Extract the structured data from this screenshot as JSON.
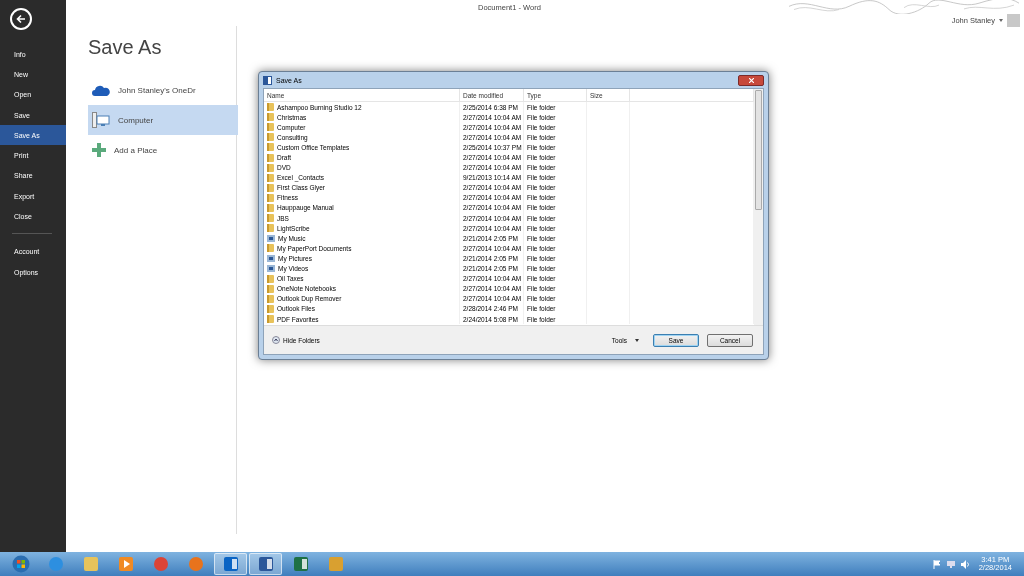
{
  "window": {
    "title": "Document1 - Word"
  },
  "account": {
    "name": "John Stanley"
  },
  "backstage": {
    "items": [
      {
        "label": "Info",
        "selected": false
      },
      {
        "label": "New",
        "selected": false
      },
      {
        "label": "Open",
        "selected": false
      },
      {
        "label": "Save",
        "selected": false
      },
      {
        "label": "Save As",
        "selected": true
      },
      {
        "label": "Print",
        "selected": false
      },
      {
        "label": "Share",
        "selected": false
      },
      {
        "label": "Export",
        "selected": false
      },
      {
        "label": "Close",
        "selected": false
      },
      {
        "label": "Account",
        "selected": false
      },
      {
        "label": "Options",
        "selected": false
      }
    ]
  },
  "page": {
    "title": "Save As",
    "places": [
      {
        "kind": "cloud",
        "label": "John Stanley's OneDr",
        "selected": false
      },
      {
        "kind": "computer",
        "label": "Computer",
        "selected": true
      },
      {
        "kind": "add",
        "label": "Add a Place",
        "selected": false
      }
    ]
  },
  "dialog": {
    "title": "Save As",
    "columns": [
      "Name",
      "Date modified",
      "Type",
      "Size"
    ],
    "rows": [
      {
        "kind": "folder",
        "name": "Ashampoo Burning Studio 12",
        "date": "2/25/2014 6:38 PM",
        "type": "File folder"
      },
      {
        "kind": "folder",
        "name": "Christmas",
        "date": "2/27/2014 10:04 AM",
        "type": "File folder"
      },
      {
        "kind": "folder",
        "name": "Computer",
        "date": "2/27/2014 10:04 AM",
        "type": "File folder"
      },
      {
        "kind": "folder",
        "name": "Consulting",
        "date": "2/27/2014 10:04 AM",
        "type": "File folder"
      },
      {
        "kind": "folder",
        "name": "Custom Office Templates",
        "date": "2/25/2014 10:37 PM",
        "type": "File folder"
      },
      {
        "kind": "folder",
        "name": "Draft",
        "date": "2/27/2014 10:04 AM",
        "type": "File folder"
      },
      {
        "kind": "folder",
        "name": "DVD",
        "date": "2/27/2014 10:04 AM",
        "type": "File folder"
      },
      {
        "kind": "folder",
        "name": "Excel _Contacts",
        "date": "9/21/2013 10:14 AM",
        "type": "File folder"
      },
      {
        "kind": "folder",
        "name": "First Class Glyer",
        "date": "2/27/2014 10:04 AM",
        "type": "File folder"
      },
      {
        "kind": "folder",
        "name": "Fitness",
        "date": "2/27/2014 10:04 AM",
        "type": "File folder"
      },
      {
        "kind": "folder",
        "name": "Hauppauge Manual",
        "date": "2/27/2014 10:04 AM",
        "type": "File folder"
      },
      {
        "kind": "folder",
        "name": "JBS",
        "date": "2/27/2014 10:04 AM",
        "type": "File folder"
      },
      {
        "kind": "folder",
        "name": "LightScribe",
        "date": "2/27/2014 10:04 AM",
        "type": "File folder"
      },
      {
        "kind": "link",
        "name": "My Music",
        "date": "2/21/2014 2:05 PM",
        "type": "File folder"
      },
      {
        "kind": "folder",
        "name": "My PaperPort Documents",
        "date": "2/27/2014 10:04 AM",
        "type": "File folder"
      },
      {
        "kind": "link",
        "name": "My Pictures",
        "date": "2/21/2014 2:05 PM",
        "type": "File folder"
      },
      {
        "kind": "link",
        "name": "My Videos",
        "date": "2/21/2014 2:05 PM",
        "type": "File folder"
      },
      {
        "kind": "folder",
        "name": "Oil Taxes",
        "date": "2/27/2014 10:04 AM",
        "type": "File folder"
      },
      {
        "kind": "folder",
        "name": "OneNote Notebooks",
        "date": "2/27/2014 10:04 AM",
        "type": "File folder"
      },
      {
        "kind": "folder",
        "name": "Outlook Dup Remover",
        "date": "2/27/2014 10:04 AM",
        "type": "File folder"
      },
      {
        "kind": "folder",
        "name": "Outlook Files",
        "date": "2/28/2014 2:46 PM",
        "type": "File folder"
      },
      {
        "kind": "folder",
        "name": "PDF Favorites",
        "date": "2/24/2014 5:08 PM",
        "type": "File folder"
      }
    ],
    "hide_folders": "Hide Folders",
    "tools": "Tools",
    "buttons": [
      {
        "kind": "primary",
        "label": "Save"
      },
      {
        "kind": "normal",
        "label": "Cancel"
      }
    ]
  },
  "taskbar": {
    "apps": [
      {
        "kind": "ie",
        "open": false
      },
      {
        "kind": "explorer",
        "open": false
      },
      {
        "kind": "media",
        "open": false
      },
      {
        "kind": "chrome",
        "open": false
      },
      {
        "kind": "firefox",
        "open": false
      },
      {
        "kind": "outlook",
        "open": true
      },
      {
        "kind": "word",
        "open": true
      },
      {
        "kind": "excel",
        "open": false
      },
      {
        "kind": "game",
        "open": false
      }
    ],
    "time": "3:41 PM",
    "date": "2/28/2014"
  }
}
